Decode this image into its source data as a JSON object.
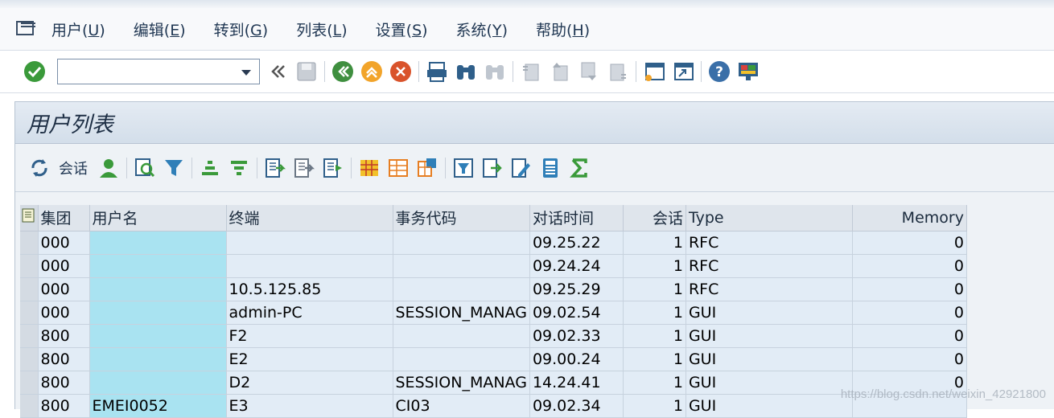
{
  "menu": {
    "items": [
      {
        "label": "用户(",
        "key": "U",
        "suffix": ")"
      },
      {
        "label": "编辑(",
        "key": "E",
        "suffix": ")"
      },
      {
        "label": "转到(",
        "key": "G",
        "suffix": ")"
      },
      {
        "label": "列表(",
        "key": "L",
        "suffix": ")"
      },
      {
        "label": "设置(",
        "key": "S",
        "suffix": ")"
      },
      {
        "label": "系统(",
        "key": "Y",
        "suffix": ")"
      },
      {
        "label": "帮助(",
        "key": "H",
        "suffix": ")"
      }
    ]
  },
  "toolbar": {
    "command_value": "",
    "icons": [
      "check-icon",
      "back-chevron-icon",
      "save-icon",
      "back-icon",
      "exit-icon",
      "cancel-icon",
      "print-icon",
      "find-icon",
      "find-next-icon",
      "first-page-icon",
      "prev-page-icon",
      "next-page-icon",
      "last-page-icon",
      "new-session-icon",
      "shortcut-icon",
      "help-icon",
      "layout-icon"
    ]
  },
  "panel": {
    "title": "用户列表",
    "session_label": "会话"
  },
  "table": {
    "columns": [
      "集团",
      "用户名",
      "终端",
      "事务代码",
      "对话时间",
      "会话",
      "Type",
      "Memory"
    ],
    "rows": [
      [
        "000",
        "",
        "",
        "",
        "09.25.22",
        "1",
        "RFC",
        "0"
      ],
      [
        "000",
        "",
        "",
        "",
        "09.24.24",
        "1",
        "RFC",
        "0"
      ],
      [
        "000",
        "",
        "10.5.125.85",
        "",
        "09.25.29",
        "1",
        "RFC",
        "0"
      ],
      [
        "000",
        "",
        "admin-PC",
        "SESSION_MANAG",
        "09.02.54",
        "1",
        "GUI",
        "0"
      ],
      [
        "800",
        "",
        "F2",
        "",
        "09.02.33",
        "1",
        "GUI",
        "0"
      ],
      [
        "800",
        "",
        "E2",
        "",
        "09.00.24",
        "1",
        "GUI",
        "0"
      ],
      [
        "800",
        "",
        "D2",
        "SESSION_MANAG",
        "14.24.41",
        "1",
        "GUI",
        "0"
      ],
      [
        "800",
        "EMEI0052",
        "E3",
        "CI03",
        "09.02.34",
        "1",
        "GUI",
        ""
      ]
    ]
  },
  "watermark": "https://blog.csdn.net/weixin_42921800",
  "colors": {
    "accent": "#1f3652",
    "user_highlight": "#a9e3f1",
    "row_bg": "#e2ecf6"
  }
}
